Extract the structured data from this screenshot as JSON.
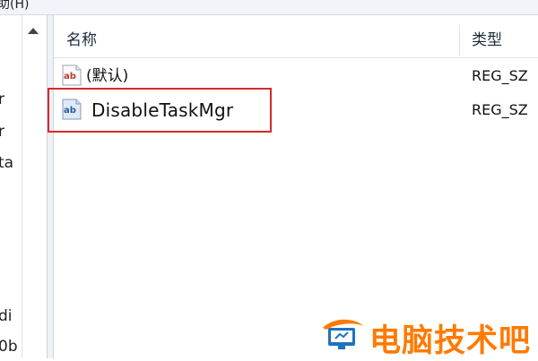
{
  "menubar": {
    "fragment": "助(H)"
  },
  "tree": {
    "items": [
      "r",
      "r",
      "ta",
      "di",
      "0b"
    ]
  },
  "list": {
    "columns": {
      "name": "名称",
      "type": "类型"
    },
    "rows": [
      {
        "icon": "reg-string-icon",
        "name": "(默认)",
        "type": "REG_SZ"
      },
      {
        "icon": "reg-string-icon",
        "name": "DisableTaskMgr",
        "type": "REG_SZ"
      }
    ]
  },
  "annotation": {
    "highlight_color": "#d9292c"
  },
  "watermark": {
    "text": "电脑技术吧",
    "color": "#ff7a00",
    "logo": "monitor-hat-logo"
  }
}
